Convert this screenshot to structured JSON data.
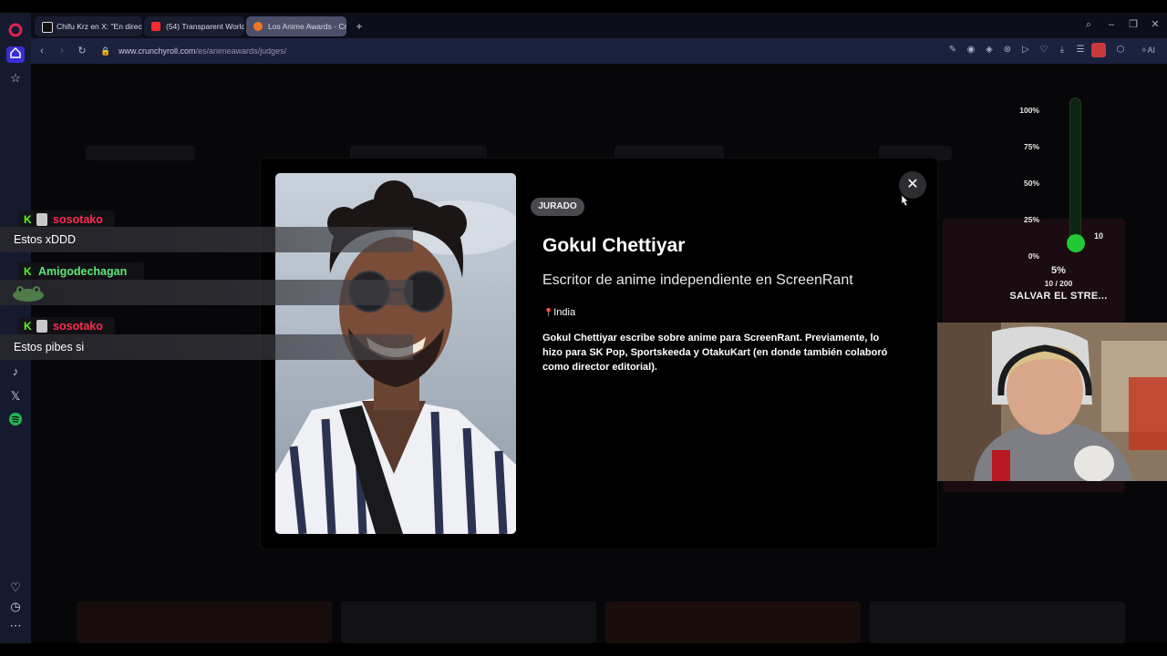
{
  "browser": {
    "tabs": [
      {
        "label": "Chifu Krz en X: \"En directo",
        "favicon_color": "#ffffff",
        "active": false
      },
      {
        "label": "(54) Transparent World – A",
        "favicon_color": "#ff2a2a",
        "active": false
      },
      {
        "label": "Los Anime Awards - Crunc",
        "favicon_color": "#f47521",
        "active": true
      }
    ],
    "new_tab": "+",
    "url_domain": "www.crunchyroll.com",
    "url_path": "/es/animeawards/judges/",
    "ai_label": "AI",
    "window_controls": [
      "search-icon",
      "minimize-icon",
      "restore-icon",
      "close-icon"
    ]
  },
  "modal": {
    "badge": "JURADO",
    "name": "Gokul Chettiyar",
    "role": "Escritor de anime independiente en ScreenRant",
    "location_pin": "📍",
    "location": "India",
    "bio": "Gokul Chettiyar escribe sobre anime para ScreenRant. Previamente, lo hizo para SK Pop, Sportskeeda y OtakuKart (en donde también colaboró como director editorial).",
    "close_symbol": "✕"
  },
  "stream_meter": {
    "ticks": [
      "100%",
      "75%",
      "50%",
      "25%",
      "0%"
    ],
    "current_value": "10",
    "percent": "5%",
    "count": "10 / 200",
    "goal_label": "SALVAR EL STRE...",
    "fill_fraction": 0.05,
    "color": "#22c935"
  },
  "chat": [
    {
      "user": "sosotako",
      "user_color": "#ff2a55",
      "message": "Estos xDDD"
    },
    {
      "user": "Amigodechagan",
      "user_color": "#5ee87a",
      "message": ""
    },
    {
      "user": "sosotako",
      "user_color": "#ff2a55",
      "message": "Estos pibes si"
    }
  ],
  "colors": {
    "browser_sidebar": "#161a2e",
    "url_bar": "#1d2140",
    "badge": "#4a4a4e"
  }
}
